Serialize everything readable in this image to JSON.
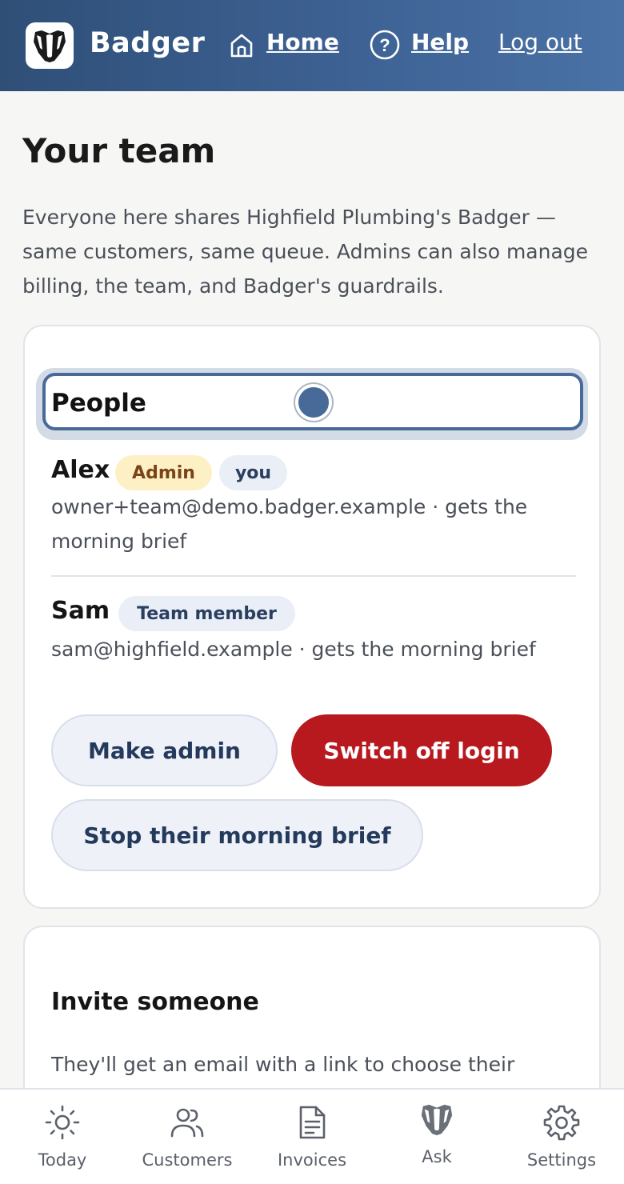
{
  "header": {
    "brand": "Badger",
    "nav": {
      "home": "Home",
      "help": "Help",
      "logout": "Log out"
    }
  },
  "page": {
    "title": "Your team",
    "intro": "Everyone here shares Highfield Plumbing's Badger — same customers, same queue. Admins can also manage billing, the team, and Badger's guardrails."
  },
  "people_card": {
    "title": "People",
    "members": [
      {
        "name": "Alex",
        "role_badge": "Admin",
        "self_badge": "you",
        "detail": "owner+team@demo.badger.example · gets the morning brief"
      },
      {
        "name": "Sam",
        "role_badge": "Team member",
        "detail": "sam@highfield.example · gets the morning brief",
        "actions": {
          "make_admin": "Make admin",
          "switch_off_login": "Switch off login",
          "stop_brief": "Stop their morning brief"
        }
      }
    ]
  },
  "invite_card": {
    "title": "Invite someone",
    "text": "They'll get an email with a link to choose their"
  },
  "bottom_nav": [
    {
      "label": "Today",
      "icon": "sun-icon"
    },
    {
      "label": "Customers",
      "icon": "people-icon"
    },
    {
      "label": "Invoices",
      "icon": "document-icon"
    },
    {
      "label": "Ask",
      "icon": "badger-icon"
    },
    {
      "label": "Settings",
      "icon": "gear-icon"
    }
  ],
  "colors": {
    "header_start": "#2f4f77",
    "header_end": "#4a72a6",
    "accent": "#486a99",
    "danger": "#b7191e",
    "admin_badge_bg": "#fdf0c5"
  }
}
